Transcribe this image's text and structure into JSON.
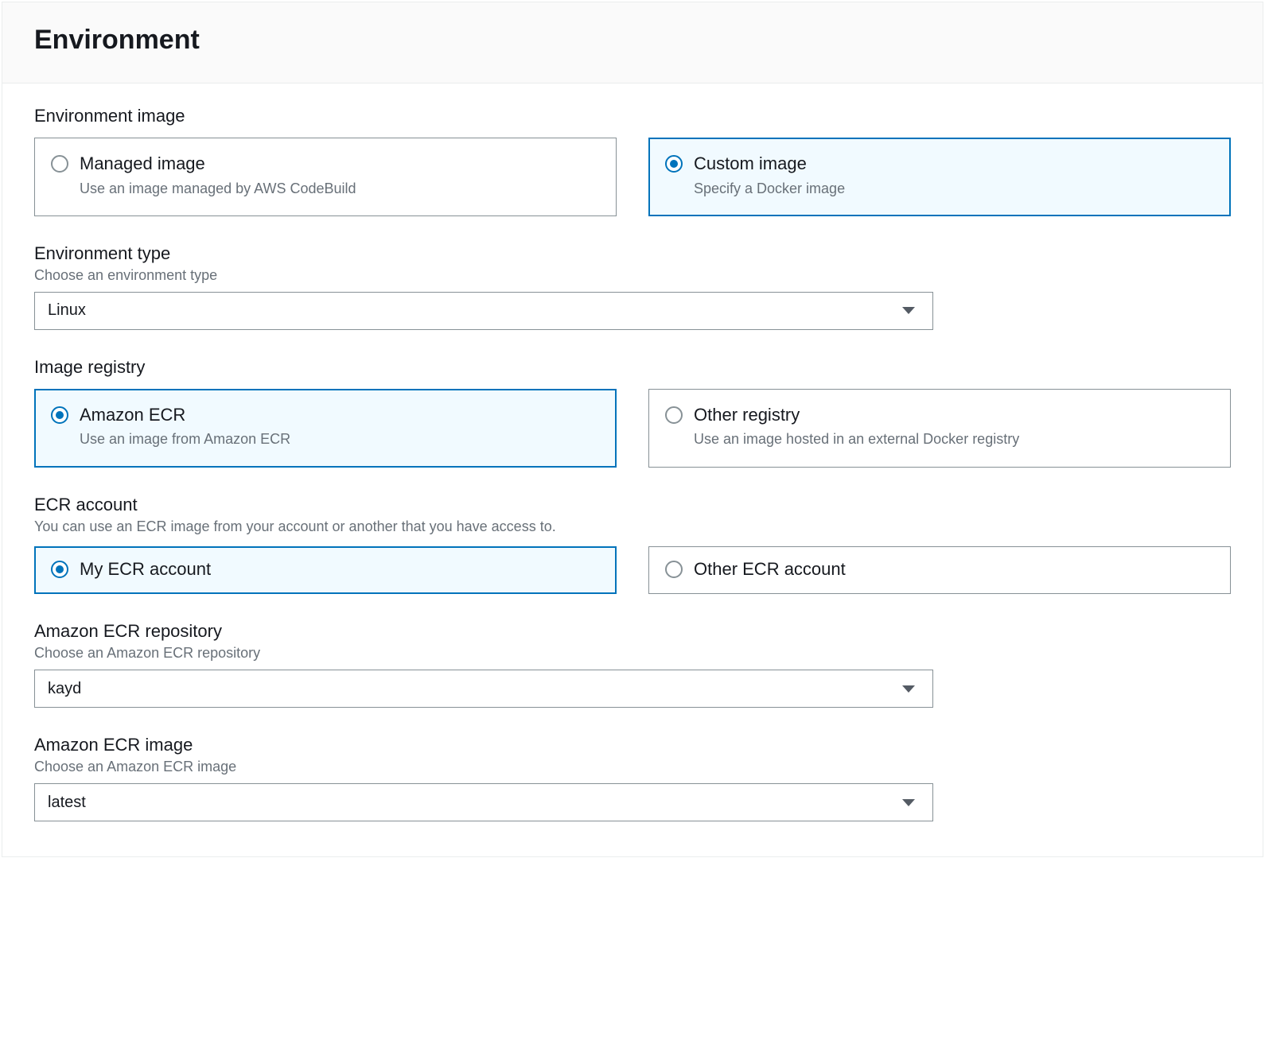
{
  "panel": {
    "title": "Environment"
  },
  "environmentImage": {
    "label": "Environment image",
    "options": [
      {
        "title": "Managed image",
        "desc": "Use an image managed by AWS CodeBuild",
        "selected": false
      },
      {
        "title": "Custom image",
        "desc": "Specify a Docker image",
        "selected": true
      }
    ]
  },
  "environmentType": {
    "label": "Environment type",
    "help": "Choose an environment type",
    "value": "Linux"
  },
  "imageRegistry": {
    "label": "Image registry",
    "options": [
      {
        "title": "Amazon ECR",
        "desc": "Use an image from Amazon ECR",
        "selected": true
      },
      {
        "title": "Other registry",
        "desc": "Use an image hosted in an external Docker registry",
        "selected": false
      }
    ]
  },
  "ecrAccount": {
    "label": "ECR account",
    "help": "You can use an ECR image from your account or another that you have access to.",
    "options": [
      {
        "title": "My ECR account",
        "selected": true
      },
      {
        "title": "Other ECR account",
        "selected": false
      }
    ]
  },
  "ecrRepository": {
    "label": "Amazon ECR repository",
    "help": "Choose an Amazon ECR repository",
    "value": "kayd"
  },
  "ecrImage": {
    "label": "Amazon ECR image",
    "help": "Choose an Amazon ECR image",
    "value": "latest"
  }
}
